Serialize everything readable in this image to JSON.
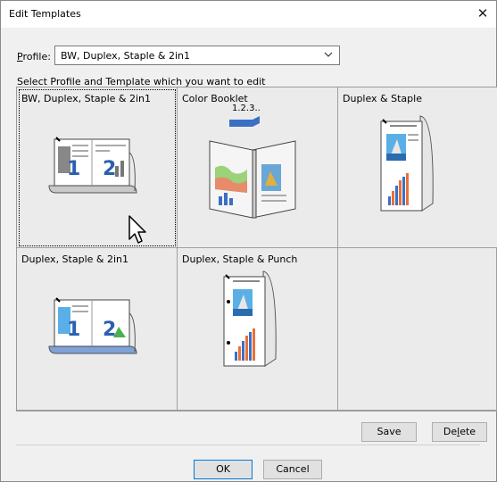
{
  "window": {
    "title": "Edit Templates",
    "close_glyph": "✕"
  },
  "profile": {
    "label_prefix": "P",
    "label_rest": "rofile:",
    "value": "BW, Duplex, Staple & 2in1"
  },
  "instruction": "Select Profile and Template which you want to edit",
  "templates": [
    {
      "label": "BW, Duplex, Staple & 2in1",
      "icon": "bw-duplex-2in1-icon",
      "selected": true
    },
    {
      "label": "Color Booklet",
      "icon": "color-booklet-icon",
      "caption": "1.2.3..",
      "selected": false
    },
    {
      "label": "Duplex & Staple",
      "icon": "duplex-staple-icon",
      "selected": false
    },
    {
      "label": "Duplex, Staple & 2in1",
      "icon": "duplex-staple-2in1-icon",
      "selected": false
    },
    {
      "label": "Duplex, Staple & Punch",
      "icon": "duplex-staple-punch-icon",
      "selected": false
    },
    {
      "label": "",
      "icon": "",
      "selected": false
    }
  ],
  "buttons": {
    "save": "Save",
    "delete_prefix": "De",
    "delete_underline": "l",
    "delete_rest": "ete",
    "ok": "OK",
    "cancel": "Cancel"
  },
  "colors": {
    "accent": "#0078d7",
    "arrow": "#3b6fc4"
  }
}
